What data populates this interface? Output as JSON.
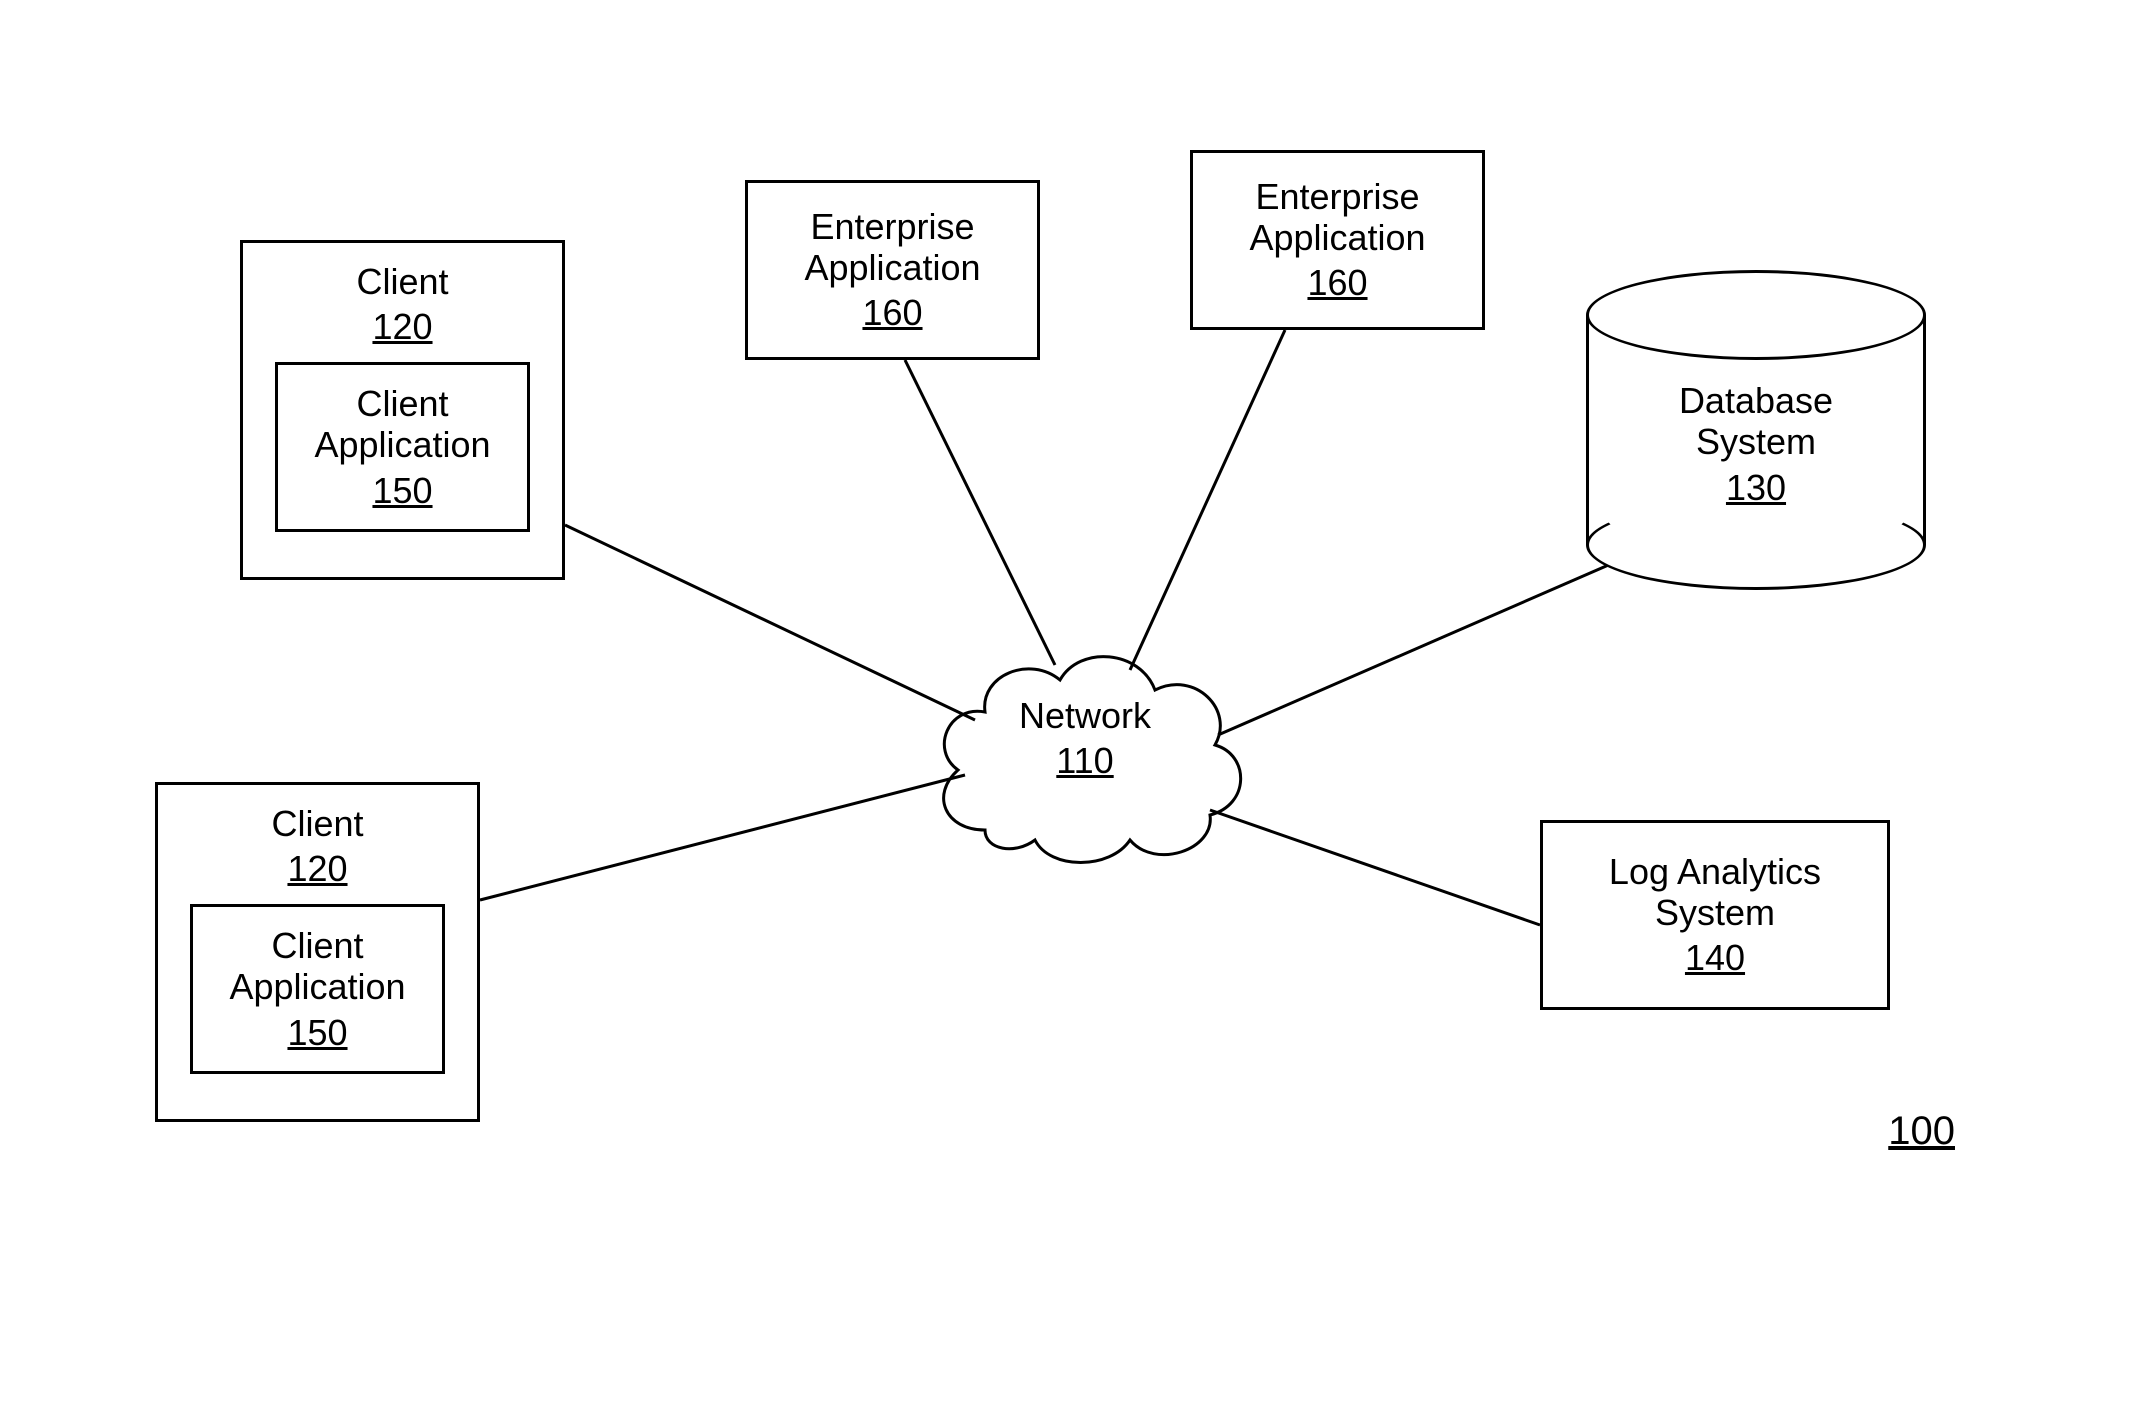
{
  "figure_ref": "100",
  "network": {
    "label": "Network",
    "ref": "110"
  },
  "client1": {
    "label": "Client",
    "ref": "120",
    "app": {
      "label_l1": "Client",
      "label_l2": "Application",
      "ref": "150"
    }
  },
  "client2": {
    "label": "Client",
    "ref": "120",
    "app": {
      "label_l1": "Client",
      "label_l2": "Application",
      "ref": "150"
    }
  },
  "ent1": {
    "label_l1": "Enterprise",
    "label_l2": "Application",
    "ref": "160"
  },
  "ent2": {
    "label_l1": "Enterprise",
    "label_l2": "Application",
    "ref": "160"
  },
  "db": {
    "label_l1": "Database",
    "label_l2": "System",
    "ref": "130"
  },
  "log": {
    "label_l1": "Log Analytics",
    "label_l2": "System",
    "ref": "140"
  }
}
